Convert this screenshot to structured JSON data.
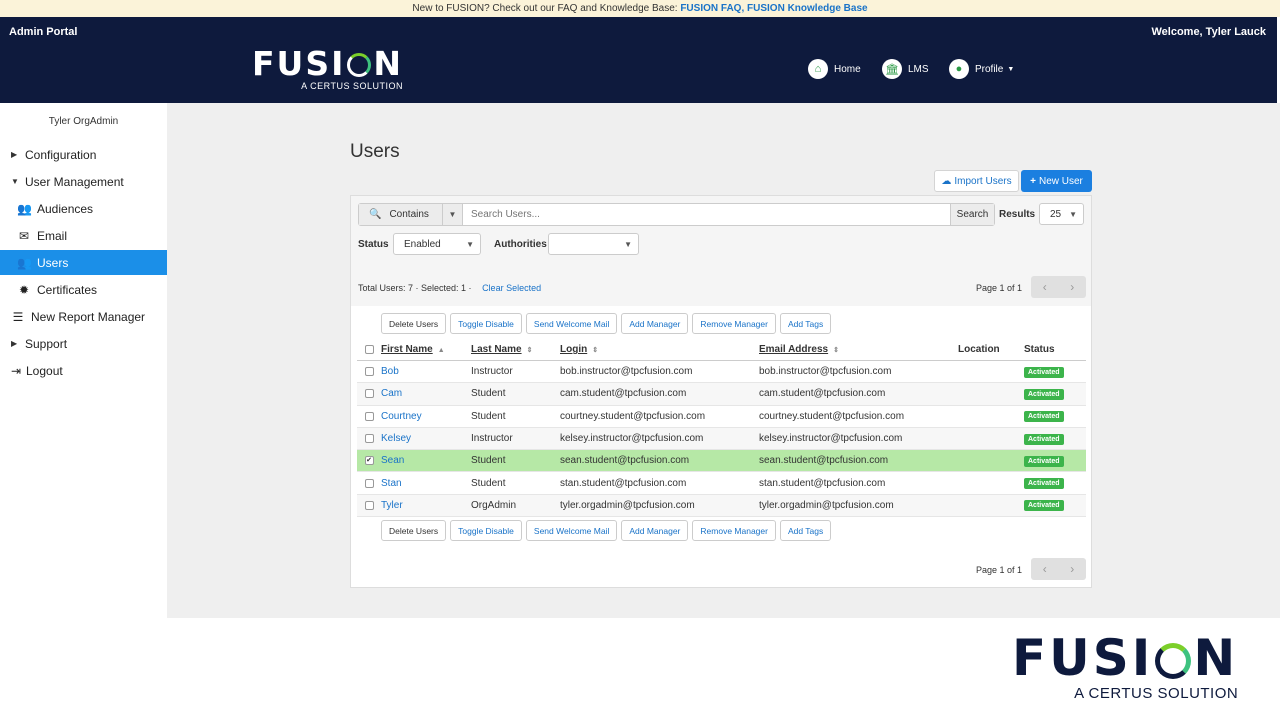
{
  "banner": {
    "text": "New to FUSION? Check out our FAQ and Knowledge Base:",
    "link1": "FUSION FAQ,",
    "link2": "FUSION Knowledge Base"
  },
  "header": {
    "portal": "Admin Portal",
    "welcome": "Welcome, Tyler Lauck",
    "logo_word_a": "FUSI",
    "logo_word_b": "N",
    "logo_sub": "A CERTUS SOLUTION",
    "nav": [
      {
        "label": "Home",
        "icon": "home-icon"
      },
      {
        "label": "LMS",
        "icon": "institution-icon"
      },
      {
        "label": "Profile",
        "icon": "user-icon"
      }
    ]
  },
  "sidebar": {
    "user": "Tyler OrgAdmin",
    "items": [
      {
        "label": "Configuration"
      },
      {
        "label": "User Management"
      },
      {
        "label": "Audiences"
      },
      {
        "label": "Email"
      },
      {
        "label": "Users"
      },
      {
        "label": "Certificates"
      },
      {
        "label": "New Report Manager"
      },
      {
        "label": "Support"
      },
      {
        "label": "Logout"
      }
    ]
  },
  "main": {
    "title": "Users",
    "import_label": "Import Users",
    "new_label": "New User",
    "search": {
      "mode": "Contains",
      "placeholder": "Search Users...",
      "button": "Search",
      "results_label": "Results",
      "results_value": "25"
    },
    "status_label": "Status",
    "status_value": "Enabled",
    "authorities_label": "Authorities",
    "authorities_value": "",
    "totals": "Total Users: 7  ·  Selected: 1  ·",
    "clear_selected": "Clear Selected",
    "page_text": "Page 1 of 1",
    "actions": [
      "Delete Users",
      "Toggle Disable",
      "Send Welcome Mail",
      "Add Manager",
      "Remove Manager",
      "Add Tags"
    ],
    "columns": [
      "First Name",
      "Last Name",
      "Login",
      "Email Address",
      "Location",
      "Status"
    ],
    "rows": [
      {
        "first": "Bob",
        "last": "Instructor",
        "login": "bob.instructor@tpcfusion.com",
        "email": "bob.instructor@tpcfusion.com",
        "location": "",
        "status": "Activated",
        "checked": ""
      },
      {
        "first": "Cam",
        "last": "Student",
        "login": "cam.student@tpcfusion.com",
        "email": "cam.student@tpcfusion.com",
        "location": "",
        "status": "Activated",
        "checked": ""
      },
      {
        "first": "Courtney",
        "last": "Student",
        "login": "courtney.student@tpcfusion.com",
        "email": "courtney.student@tpcfusion.com",
        "location": "",
        "status": "Activated",
        "checked": ""
      },
      {
        "first": "Kelsey",
        "last": "Instructor",
        "login": "kelsey.instructor@tpcfusion.com",
        "email": "kelsey.instructor@tpcfusion.com",
        "location": "",
        "status": "Activated",
        "checked": ""
      },
      {
        "first": "Sean",
        "last": "Student",
        "login": "sean.student@tpcfusion.com",
        "email": "sean.student@tpcfusion.com",
        "location": "",
        "status": "Activated",
        "checked": "✔"
      },
      {
        "first": "Stan",
        "last": "Student",
        "login": "stan.student@tpcfusion.com",
        "email": "stan.student@tpcfusion.com",
        "location": "",
        "status": "Activated",
        "checked": ""
      },
      {
        "first": "Tyler",
        "last": "OrgAdmin",
        "login": "tyler.orgadmin@tpcfusion.com",
        "email": "tyler.orgadmin@tpcfusion.com",
        "location": "",
        "status": "Activated",
        "checked": ""
      }
    ]
  },
  "footer_logo": {
    "word_a": "FUSI",
    "word_b": "N",
    "sub": "A CERTUS SOLUTION"
  }
}
